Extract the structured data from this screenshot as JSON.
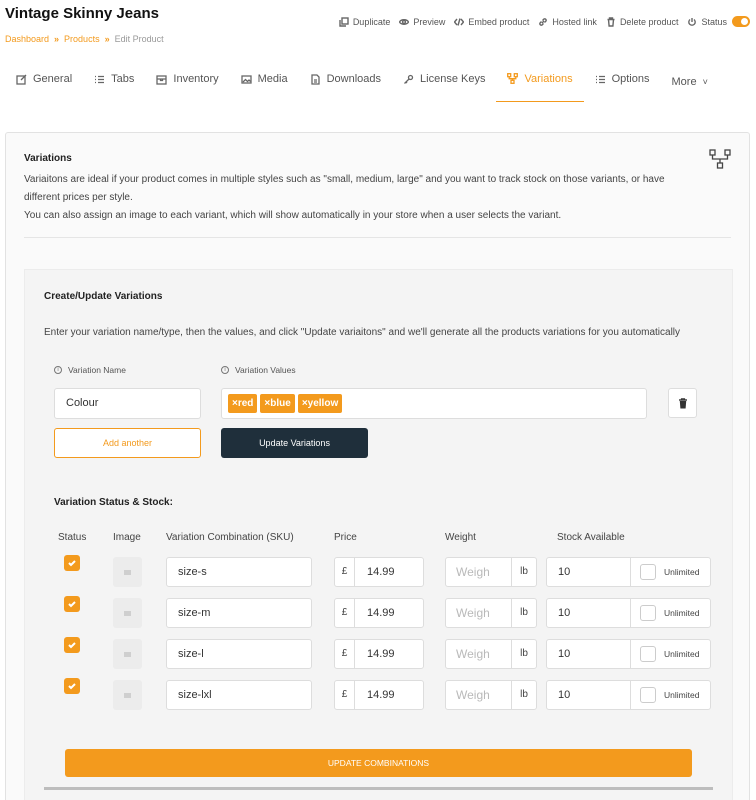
{
  "header": {
    "title": "Vintage Skinny Jeans",
    "breadcrumb": [
      "Dashboard",
      "Products",
      "Edit Product"
    ],
    "actions": [
      {
        "label": "Duplicate",
        "icon": "copy-icon"
      },
      {
        "label": "Preview",
        "icon": "eye-icon"
      },
      {
        "label": "Embed product",
        "icon": "code-icon"
      },
      {
        "label": "Hosted link",
        "icon": "link-icon"
      },
      {
        "label": "Delete product",
        "icon": "trash-icon"
      },
      {
        "label": "Status",
        "icon": "power-icon"
      }
    ],
    "status_on": true
  },
  "tabs": [
    {
      "label": "General",
      "icon": "edit-icon"
    },
    {
      "label": "Tabs",
      "icon": "list-icon"
    },
    {
      "label": "Inventory",
      "icon": "box-icon"
    },
    {
      "label": "Media",
      "icon": "image-icon"
    },
    {
      "label": "Downloads",
      "icon": "file-icon"
    },
    {
      "label": "License Keys",
      "icon": "key-icon"
    },
    {
      "label": "Variations",
      "icon": "variations-icon",
      "active": true
    },
    {
      "label": "Options",
      "icon": "options-icon"
    },
    {
      "label": "More",
      "icon": "chevron-down-icon"
    }
  ],
  "variations": {
    "title": "Variations",
    "desc1": "Variaitons are ideal if your product comes in multiple styles such as \"small, medium, large\" and you want to track stock on those variants, or have different prices per style.",
    "desc2": "You can also assign an image to each variant, which will show automatically in your store when a user selects the variant."
  },
  "create": {
    "title": "Create/Update Variations",
    "desc": "Enter your variation name/type, then the values, and click \"Update variaitons\" and we'll generate all the products variations for you automatically",
    "name_label": "Variation Name",
    "values_label": "Variation Values",
    "name_value": "Colour",
    "values": [
      "×red",
      "×blue",
      "×yellow"
    ],
    "add_label": "Add another",
    "update_label": "Update Variations"
  },
  "stock": {
    "title": "Variation Status & Stock:",
    "headers": {
      "status": "Status",
      "image": "Image",
      "sku": "Variation Combination (SKU)",
      "price": "Price",
      "weight": "Weight",
      "stock": "Stock Available"
    },
    "currency": "£",
    "weight_placeholder": "Weigh",
    "weight_unit": "lb",
    "unlimited_label": "Unlimited",
    "rows": [
      {
        "sku": "size-s",
        "price": "14.99",
        "stock": "10",
        "checked": true
      },
      {
        "sku": "size-m",
        "price": "14.99",
        "stock": "10",
        "checked": true
      },
      {
        "sku": "size-l",
        "price": "14.99",
        "stock": "10",
        "checked": true
      },
      {
        "sku": "size-lxl",
        "price": "14.99",
        "stock": "10",
        "checked": true
      }
    ],
    "combo_label": "UPDATE COMBINATIONS"
  },
  "colors": {
    "accent": "#f39a1d",
    "dark_button": "#1f2f3b"
  }
}
